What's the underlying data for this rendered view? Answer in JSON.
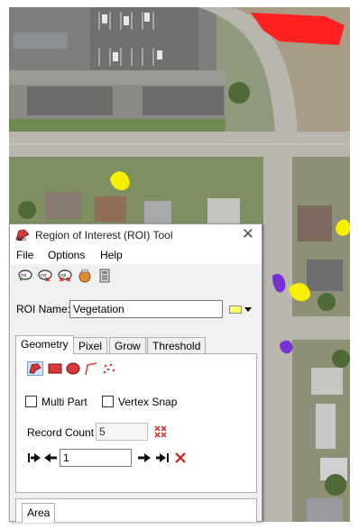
{
  "window": {
    "title": "Region of Interest (ROI) Tool",
    "close_glyph": "✕"
  },
  "menu": {
    "file": "File",
    "options": "Options",
    "help": "Help"
  },
  "toolbar": {
    "icons": [
      "new-roi-icon",
      "delete-roi-icon",
      "delete-all-roi-icon",
      "roi-options-icon",
      "stats-calculator-icon"
    ]
  },
  "roi": {
    "name_label": "ROI Name:",
    "name_value": "Vegetation",
    "color": "#ffff66"
  },
  "tabs": [
    "Geometry",
    "Pixel",
    "Grow",
    "Threshold"
  ],
  "geometry": {
    "multi_part": "Multi Part",
    "vertex_snap": "Vertex Snap",
    "record_count_label": "Record Count",
    "record_count_value": "5",
    "record_index": "1"
  },
  "bottom_tab": "Area",
  "colors": {
    "red_roi": "#ff2020",
    "yellow_roi": "#f6f000",
    "purple_roi": "#7a2ed6",
    "road": "#b9b6ae"
  }
}
